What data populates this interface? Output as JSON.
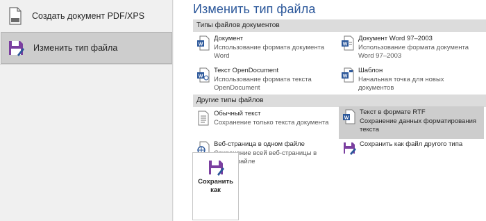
{
  "nav": {
    "create_pdf_label": "Создать документ PDF/XPS",
    "change_type_label": "Изменить тип файла"
  },
  "title": "Изменить тип файла",
  "doc_section": {
    "header": "Типы файлов документов",
    "items": [
      {
        "title": "Документ",
        "desc": "Использование формата документа Word",
        "icon": "word-document-icon"
      },
      {
        "title": "Документ Word 97–2003",
        "desc": "Использование формата документа Word 97–2003",
        "icon": "word-97-2003-icon"
      },
      {
        "title": "Текст OpenDocument",
        "desc": "Использование формата текста OpenDocument",
        "icon": "opendocument-icon"
      },
      {
        "title": "Шаблон",
        "desc": "Начальная точка для новых документов",
        "icon": "word-template-icon"
      }
    ]
  },
  "other_section": {
    "header": "Другие типы файлов",
    "items": [
      {
        "title": "Обычный текст",
        "desc": "Сохранение только текста документа",
        "icon": "plain-text-icon"
      },
      {
        "title": "Текст в формате RTF",
        "desc": "Сохранение данных форматирования текста",
        "icon": "rtf-icon"
      },
      {
        "title": "Веб-страница в одном файле",
        "desc": "Сохранение всей веб-страницы в одном файле",
        "icon": "web-page-icon"
      },
      {
        "title": "Сохранить как файл другого типа",
        "desc": "",
        "icon": "save-other-icon"
      }
    ]
  },
  "save_as_label": "Сохранить как",
  "colors": {
    "accent": "#2b579a",
    "purple": "#7b3fa0",
    "selected": "#cdcdcd"
  }
}
